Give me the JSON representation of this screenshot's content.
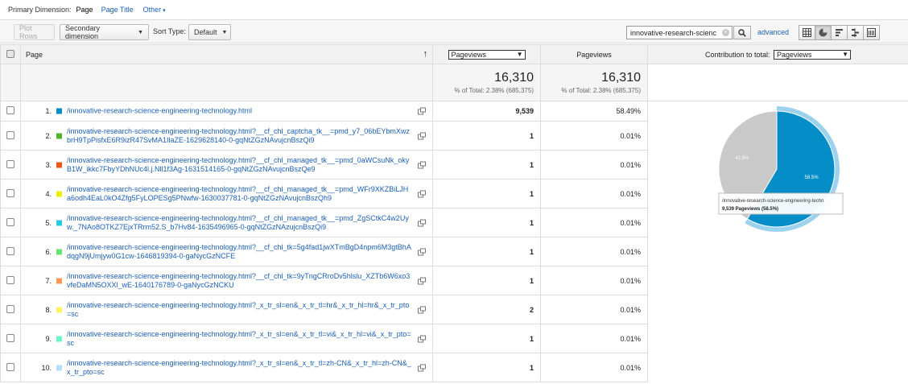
{
  "dimension": {
    "label": "Primary Dimension:",
    "current": "Page",
    "options": [
      "Page Title",
      "Other"
    ]
  },
  "toolbar": {
    "plot_rows": "Plot Rows",
    "secondary_dimension": "Secondary dimension",
    "sort_type_label": "Sort Type:",
    "sort_type_value": "Default",
    "search_value": "innovative-research-scienc",
    "advanced": "advanced"
  },
  "table": {
    "headers": {
      "page": "Page",
      "metric_select": "Pageviews",
      "pageviews": "Pageviews",
      "contribution_label": "Contribution to total:",
      "contribution_select": "Pageviews"
    },
    "summary": {
      "value1": "16,310",
      "pct1": "% of Total: 2.38% (685,375)",
      "value2": "16,310",
      "pct2": "% of Total: 2.38% (685,375)"
    },
    "rows": [
      {
        "num": "1.",
        "color": "#058dc7",
        "page": "/innovative-research-science-engineering-technology.html",
        "pageviews": "9,539",
        "pct": "58.49%"
      },
      {
        "num": "2.",
        "color": "#50b432",
        "page": "/innovative-research-science-engineering-technology.html?__cf_chl_captcha_tk__=pmd_y7_06bEYbmXwzbrH9TpPisfxE6R9izR47SvMA1IlaZE-1629628140-0-gqNtZGzNAvujcnBszQi9",
        "pageviews": "1",
        "pct": "0.01%"
      },
      {
        "num": "3.",
        "color": "#ed561b",
        "page": "/innovative-research-science-engineering-technology.html?__cf_chl_managed_tk__=pmd_0aWCsuNk_okyB1W_ikkc7FbyYDhNUc4l.j.Nll1f3Ag-1631514165-0-gqNtZGzNAvujcnBszQe9",
        "pageviews": "1",
        "pct": "0.01%"
      },
      {
        "num": "4.",
        "color": "#edef00",
        "page": "/innovative-research-science-engineering-technology.html?__cf_chl_managed_tk__=pmd_WFr9XKZBiLJHa6odh4EaL0kO4Zfg5FyLOPESg5PNwfw-1630037781-0-gqNtZGzNAvujcnBszQh9",
        "pageviews": "1",
        "pct": "0.01%"
      },
      {
        "num": "5.",
        "color": "#24cbe5",
        "page": "/innovative-research-science-engineering-technology.html?__cf_chl_managed_tk__=pmd_ZgSCtkC4w2Uyw._7NAo8OTKZ7EjxTRrm52.S_b7Hv84-1635496965-0-gqNtZGzNAzujcnBszQi9",
        "pageviews": "1",
        "pct": "0.01%"
      },
      {
        "num": "6.",
        "color": "#64e572",
        "page": "/innovative-research-science-engineering-technology.html?__cf_chl_tk=5g4fad1jwXTmBgD4npm6M3gtBhAdqgN9jUmjyw0G1cw-1646819394-0-gaNycGzNCFE",
        "pageviews": "1",
        "pct": "0.01%"
      },
      {
        "num": "7.",
        "color": "#ff9655",
        "page": "/innovative-research-science-engineering-technology.html?__cf_chl_tk=9yTngCRroDv5hlslu_XZTb6W6xo3vfeDaMN5OXXl_wE-1640176789-0-gaNycGzNCKU",
        "pageviews": "1",
        "pct": "0.01%"
      },
      {
        "num": "8.",
        "color": "#fff263",
        "page": "/innovative-research-science-engineering-technology.html?_x_tr_sl=en&_x_tr_tl=hr&_x_tr_hl=hr&_x_tr_pto=sc",
        "pageviews": "2",
        "pct": "0.01%"
      },
      {
        "num": "9.",
        "color": "#6af9c4",
        "page": "/innovative-research-science-engineering-technology.html?_x_tr_sl=en&_x_tr_tl=vi&_x_tr_hl=vi&_x_tr_pto=sc",
        "pageviews": "1",
        "pct": "0.01%"
      },
      {
        "num": "10.",
        "color": "#b2deff",
        "page": "/innovative-research-science-engineering-technology.html?_x_tr_sl=en&_x_tr_tl=zh-CN&_x_tr_hl=zh-CN&_x_tr_pto=sc",
        "pageviews": "1",
        "pct": "0.01%"
      }
    ]
  },
  "chart_data": {
    "type": "pie",
    "slices": [
      {
        "label": "58.5%",
        "value": 58.5,
        "color": "#058dc7"
      },
      {
        "label": "41.5%",
        "value": 41.5,
        "color": "#c9c9c9"
      }
    ],
    "tooltip": {
      "line1": "/innovative-research-science-engineering-techn",
      "line2": "9,539 Pageviews (58.5%)"
    }
  }
}
